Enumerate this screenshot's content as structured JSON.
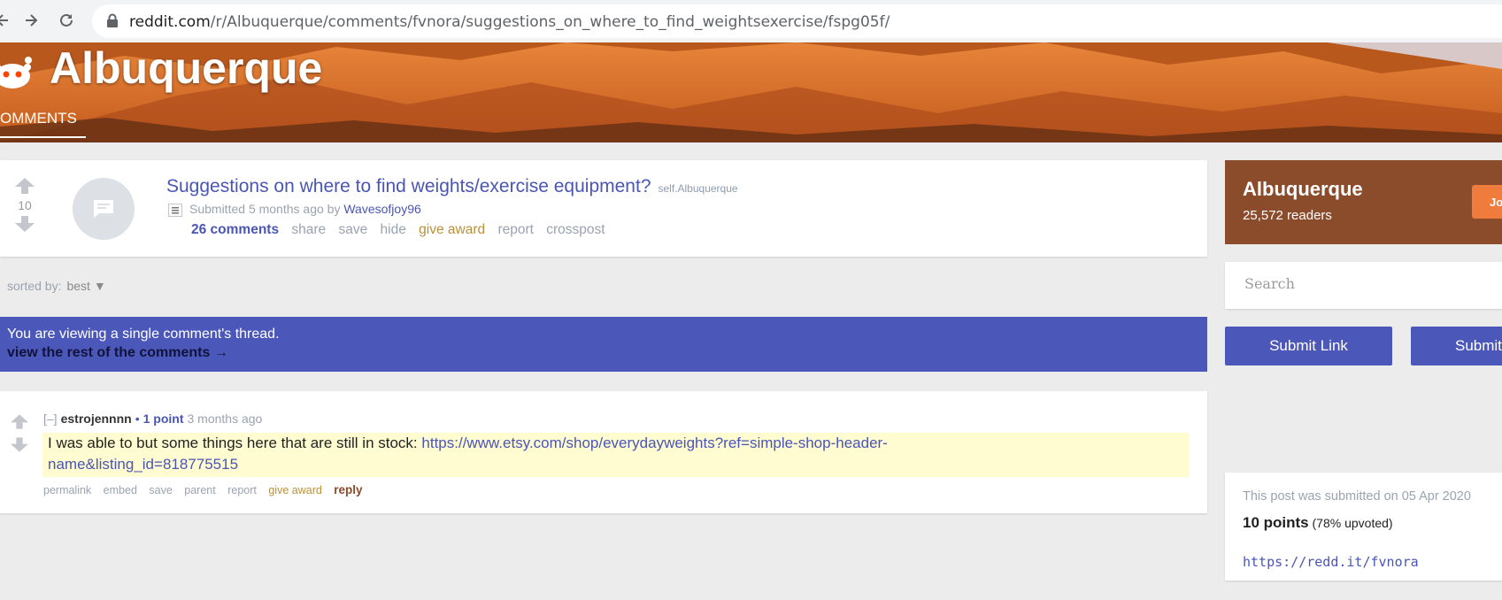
{
  "browser": {
    "url_host": "reddit.com",
    "url_path": "/r/Albuquerque/comments/fvnora/suggestions_on_where_to_find_weightsexercise/fspg05f/"
  },
  "banner": {
    "title": "Albuquerque",
    "tab": "OMMENTS"
  },
  "post": {
    "score": "10",
    "title": "Suggestions on where to find weights/exercise equipment?",
    "domain": "self.Albuquerque",
    "submitted_prefix": "Submitted",
    "submitted_time": "5 months ago",
    "by": "by",
    "author": "Wavesofjoy96",
    "buttons": {
      "comments": "26 comments",
      "share": "share",
      "save": "save",
      "hide": "hide",
      "give_award": "give award",
      "report": "report",
      "crosspost": "crosspost"
    }
  },
  "sort": {
    "label": "sorted by:",
    "value": "best ▼"
  },
  "thread_notice": {
    "line1": "You are viewing a single comment's thread.",
    "line2": "view the rest of the comments →"
  },
  "comment": {
    "toggle": "[–]",
    "author": "estrojennnn",
    "score": "1 point",
    "time": "3 months ago",
    "body_text": "I was able to but some things here that are still in stock: ",
    "body_link_line1": "https://www.etsy.com/shop/everydayweights?ref=simple-shop-header-",
    "body_link_line2": "name&listing_id=818775515",
    "buttons": {
      "permalink": "permalink",
      "embed": "embed",
      "save": "save",
      "parent": "parent",
      "report": "report",
      "give_award": "give award",
      "reply": "reply"
    }
  },
  "sidebar": {
    "sub_name": "Albuquerque",
    "readers": "25,572 readers",
    "join_label": "Joi",
    "search_placeholder": "Search",
    "submit_link": "Submit Link",
    "submit_text": "Submit",
    "submitted_on": "This post was submitted on 05 Apr 2020",
    "points": "10 points",
    "upvoted": "(78% upvoted)",
    "shortlink": "https://redd.it/fvnora"
  },
  "colors": {
    "accent": "#4c57ba",
    "sidebar_brown": "#8b4c2c",
    "award": "#b8913a",
    "comment_highlight": "#fefcd0"
  }
}
